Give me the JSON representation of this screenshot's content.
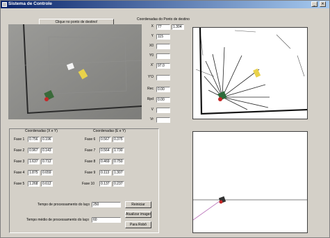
{
  "window": {
    "title": "Sistema de Controle"
  },
  "camera": {
    "click_button": "Clique no ponto de destino!"
  },
  "target": {
    "heading": "Coordenadas do Ponto de destino",
    "x_label": "X",
    "x_value": "77",
    "x_value2": "1.304",
    "y_label": "Y",
    "y_value": "115",
    "rows": [
      {
        "label": "X0",
        "value": ""
      },
      {
        "label": "Y0",
        "value": ""
      },
      {
        "label": "X'",
        "value": "97.0"
      },
      {
        "label": "Y'O",
        "value": ""
      },
      {
        "label": "Rec",
        "value": "0.00"
      },
      {
        "label": "Rpd",
        "value": "0.00"
      },
      {
        "label": "V",
        "value": ""
      },
      {
        "label": "Vr",
        "value": ""
      }
    ]
  },
  "coords": {
    "left_heading": "Coordenadas (X e Y)",
    "right_heading": "Coordenadas (E e Y)",
    "left_rows": [
      {
        "label": "Fase 1",
        "a": "0.756",
        "b": "0.196"
      },
      {
        "label": "Fase 2",
        "a": "0.967",
        "b": "0.143"
      },
      {
        "label": "Fase 3",
        "a": "1.637",
        "b": "0.712"
      },
      {
        "label": "Fase 4",
        "a": "1.875",
        "b": "0.659"
      },
      {
        "label": "Fase 5",
        "a": "1.268",
        "b": "0.612"
      }
    ],
    "right_rows": [
      {
        "label": "Fase 6",
        "a": "0.567",
        "b": "0.375"
      },
      {
        "label": "Fase 7",
        "a": "0.564",
        "b": "1.730"
      },
      {
        "label": "Fase 8",
        "a": "0.469",
        "b": "0.750"
      },
      {
        "label": "Fase 9",
        "a": "0.113",
        "b": "1.307"
      },
      {
        "label": "Fase 10",
        "a": "0.137",
        "b": "0.237"
      }
    ]
  },
  "timing": {
    "current_label": "Tempo de processamento do laço",
    "current_value": "250",
    "average_label": "Tempo médio de processamento do laço",
    "average_value": "60"
  },
  "buttons": {
    "restart": "Reiniciar",
    "update_image": "Atualizar imagem",
    "stop_robot": "Para Robô"
  }
}
